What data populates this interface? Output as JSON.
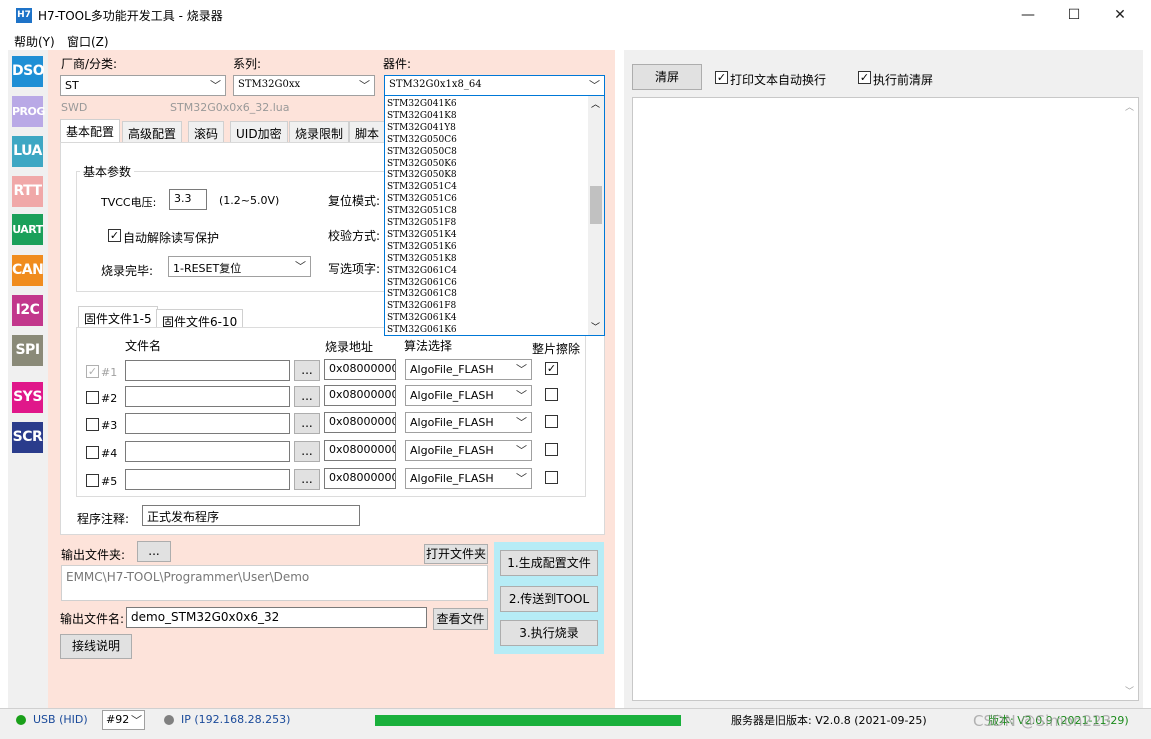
{
  "window": {
    "icon_text": "H7",
    "title": "H7-TOOL多功能开发工具 - 烧录器",
    "minimize": "—",
    "maximize": "☐",
    "close": "✕"
  },
  "menu": [
    "帮助(Y)",
    "窗口(Z)"
  ],
  "sidebar": [
    {
      "label": "DSO",
      "color": "#1e8fd5"
    },
    {
      "label": "PROG",
      "color": "#b9a9e6"
    },
    {
      "label": "LUA",
      "color": "#3da7c3"
    },
    {
      "label": "RTT",
      "color": "#f0a8a8"
    },
    {
      "label": "UART",
      "color": "#1aa05a"
    },
    {
      "label": "CAN",
      "color": "#f08c1e"
    },
    {
      "label": "I2C",
      "color": "#c2378c"
    },
    {
      "label": "SPI",
      "color": "#8a8a78"
    },
    {
      "label": "SYS",
      "color": "#e0178a"
    },
    {
      "label": "SCR",
      "color": "#2a3c8c"
    }
  ],
  "selectors": {
    "vendor_label": "厂商/分类:",
    "vendor_value": "ST",
    "series_label": "系列:",
    "series_value": "STM32G0xx",
    "device_label": "器件:",
    "device_value": "STM32G0x1x8_64",
    "interface": "SWD",
    "lua_file": "STM32G0x0x6_32.lua"
  },
  "device_list": [
    "STM32G041K6",
    "STM32G041K8",
    "STM32G041Y8",
    "STM32G050C6",
    "STM32G050C8",
    "STM32G050K6",
    "STM32G050K8",
    "STM32G051C4",
    "STM32G051C6",
    "STM32G051C8",
    "STM32G051F8",
    "STM32G051K4",
    "STM32G051K6",
    "STM32G051K8",
    "STM32G061C4",
    "STM32G061C6",
    "STM32G061C8",
    "STM32G061F8",
    "STM32G061K4",
    "STM32G061K6"
  ],
  "tabs": [
    "基本配置",
    "高级配置",
    "滚码",
    "UID加密",
    "烧录限制",
    "脚本"
  ],
  "basic": {
    "group_title": "基本参数",
    "tvcc_label": "TVCC电压:",
    "tvcc_value": "3.3",
    "tvcc_range": "(1.2~5.0V)",
    "reset_mode_label": "复位模式:",
    "verify_label": "校验方式:",
    "option_label": "写选项字:",
    "auto_unprotect": "自动解除读写保护",
    "finish_label": "烧录完毕:",
    "finish_value": "1-RESET复位"
  },
  "firmware": {
    "tab1": "固件文件1-5",
    "tab2": "固件文件6-10",
    "col_name": "文件名",
    "col_addr": "烧录地址",
    "col_algo": "算法选择",
    "col_erase": "整片擦除",
    "browse": "...",
    "rows": [
      {
        "id": "#1",
        "checked": "✓",
        "addr": "0x08000000",
        "algo": "AlgoFile_FLASH",
        "erase": "✓"
      },
      {
        "id": "#2",
        "checked": "",
        "addr": "0x08000000",
        "algo": "AlgoFile_FLASH",
        "erase": ""
      },
      {
        "id": "#3",
        "checked": "",
        "addr": "0x08000000",
        "algo": "AlgoFile_FLASH",
        "erase": ""
      },
      {
        "id": "#4",
        "checked": "",
        "addr": "0x08000000",
        "algo": "AlgoFile_FLASH",
        "erase": ""
      },
      {
        "id": "#5",
        "checked": "",
        "addr": "0x08000000",
        "algo": "AlgoFile_FLASH",
        "erase": ""
      }
    ]
  },
  "note_label": "程序注释:",
  "note_value": "正式发布程序",
  "output": {
    "folder_label": "输出文件夹:",
    "browse": "...",
    "open_folder": "打开文件夹",
    "path": "EMMC\\H7-TOOL\\Programmer\\User\\Demo",
    "filename_label": "输出文件名:",
    "filename_value": "demo_STM32G0x0x6_32",
    "view_file": "查看文件",
    "wiring": "接线说明"
  },
  "actions": [
    "1.生成配置文件",
    "2.传送到TOOL",
    "3.执行烧录"
  ],
  "console": {
    "clear": "清屏",
    "auto_wrap": "打印文本自动换行",
    "clear_before": "执行前清屏"
  },
  "status": {
    "usb": "USB (HID)",
    "device_no": "#92",
    "ip": "IP (192.168.28.253)",
    "progress": 1.0,
    "server_version": "服务器是旧版本: V2.0.8 (2021-09-25)",
    "local_version": "版本: V2.0.9 (2021-11-29)",
    "watermark": "CSDN @Simon223",
    "usb_color": "#1aa01a",
    "ip_color": "#808080",
    "progress_color": "#1ab03c"
  }
}
